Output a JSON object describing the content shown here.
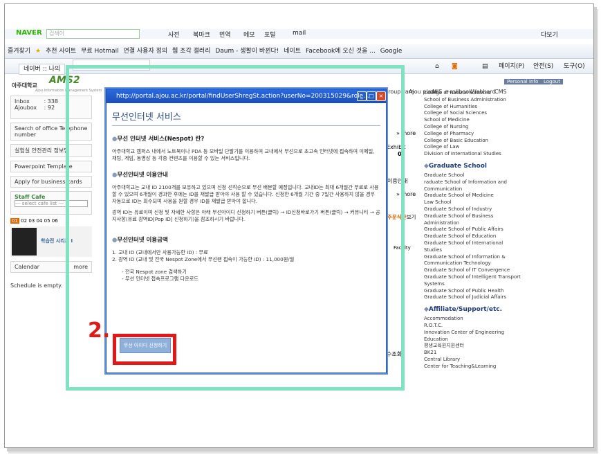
{
  "browser": {
    "search_brand": "NAVER",
    "search_placeholder": "검색어",
    "fav_label": "즐겨찾기",
    "favorites": [
      "추천 사이트",
      "무료 Hotmail",
      "연결 사용자 정의",
      "웹 조각 갤러리",
      "Daum - 생활이 바뀐다!",
      "네이트",
      "Facebook에 오신 것을 ...",
      "Google"
    ],
    "tab_label": "네이버 :: 나의",
    "right_tools": [
      "페이지(P)",
      "안전(S)",
      "도구(O)"
    ],
    "right_top": "다보기",
    "toolbar_items": [
      "사전",
      "북마크",
      "번역",
      "메모",
      "포털",
      "mail"
    ]
  },
  "portal": {
    "logo_text": "AMS2",
    "univ": "아주대학교",
    "subtitle": "Ajou Information Management System",
    "nav": [
      "Groupware",
      "Ajou plaza",
      "MIS",
      "e-rollbook",
      "Webhard",
      "CMS"
    ],
    "personal_info": "Personal Info",
    "logout": "Logout",
    "inbox_label": "Inbox",
    "inbox_count": ": 338",
    "ajoubox_label": "Ajoubox",
    "ajoubox_count": ": 92",
    "left_links": [
      "Search of office Telephone number",
      "실험실 안전관리 정보망",
      "Powerpoint Template",
      "Apply for business cards"
    ],
    "staff_cafe": "Staff Cafe",
    "cafe_select": "--- select cafe list ---",
    "date_tabs": [
      "01",
      "02",
      "03",
      "04",
      "05",
      "06"
    ],
    "banner_text": "학습전 시리즈 I",
    "calendar": "Calendar",
    "calendar_more": "more",
    "schedule_empty": "Schedule is empty.",
    "more1": "» more",
    "more2": "» more",
    "exhibit": "Exhibit",
    "exhibit_count": "0",
    "mid_notice": "이용안내",
    "menu_link": "주문식단",
    "menu_link2": "보기",
    "faculty": "Faculty",
    "mid_search": "수조회)",
    "colleges": [
      "College of Natural Sciences",
      "School of Business Administration",
      "College of Humanities",
      "College of Social Sciences",
      "School of Medicine",
      "College of Nursing",
      "College of Pharmacy",
      "College of Basic Education",
      "College of Law",
      "Division of International Studies"
    ],
    "graduate_header": "Graduate School",
    "graduate": [
      "Graduate School",
      "raduate School of Information and Communication",
      "Graduate School of Medicine",
      "Law School",
      "Graduate School of Industry",
      "Graduate School of Business Administration",
      "Graduate School of Public Affairs",
      "Graduate School of Education",
      "Graduate School of International Studies",
      "Graduate School of Information & Communication Technology",
      "Graduate School of IT Convergence",
      "Graduate School of Intelligent Transport Systems",
      "Graduate School of Public Health",
      "Graduate School of Judicial Affairs"
    ],
    "affiliate_header": "Affiliate/Support/etc.",
    "affiliate": [
      "Accommodation",
      "R.O.T.C.",
      "Innovation Center of Engineering Education",
      "평생교육원지원센터",
      "BK21",
      "Central Library",
      "Center for Teaching&Learning"
    ]
  },
  "popup": {
    "title": "http://portal.ajou.ac.kr/portal/findUserShregSt.action?userNo=200315029&role...",
    "heading": "무선인터넷 서비스",
    "s1_title": "무선 인터넷 서비스(Nespot) 란?",
    "s1_body": "아주대학교 캠퍼스 내에서 노트북이나 PDA 등 모바일 단말기를 이용하여 교내에서 무선으로 초고속 인터넷에 접속하여 이메일, 채팅, 게임, 동영상 등 각종 컨텐츠를 이용할 수 있는 서비스입니다.",
    "s2_title": "무선인터넷 이용안내",
    "s2_body1": "아주대학교는 교내 ID 2100개를 보유하고 있으며 신청 선착순으로 무선 배분할 예정입니다. 교내ID는 최대 6개월간 무료로 사용할 수 있으며 6개월이 경과한 후에는 ID를 재발급 받아야 사용 할 수 있습니다. 신청한 6개월 기간 중 7일간 사용하지 않을 경우 자동으로 ID는 회수되며 사용을 원할 경우 ID를 재발급 받아야 합니다.",
    "s2_body2": "광역 ID는 유료이며 신청 및 자세한 사항은 아래 무선아이디 신청하기 버튼(클릭) → ID신청바로가기 버튼(클릭) → 커뮤니티 → 공지사항(유료 광역ID[Pop ID] 신청하기)을 참조하시기 바랍니다.",
    "s3_title": "무선인터넷 이용금액",
    "fee1": "1. 교내 ID (교내에서만 사용가능한 ID) : 무료",
    "fee2": "2. 광역 ID (교내 및 전국 Nespot Zone에서 무선랜 접속이 가능한 ID) : 11,000원/월",
    "link1": "- 전국 Nespot zone 검색하기",
    "link2": "- 무선 인터넷 접속프로그램 다운로드",
    "apply_button": "무선 아이디 신청하기"
  },
  "annotation": {
    "step_label": "2.",
    "highlight_color": "#e01818",
    "outline_color": "#7fe3c2"
  }
}
